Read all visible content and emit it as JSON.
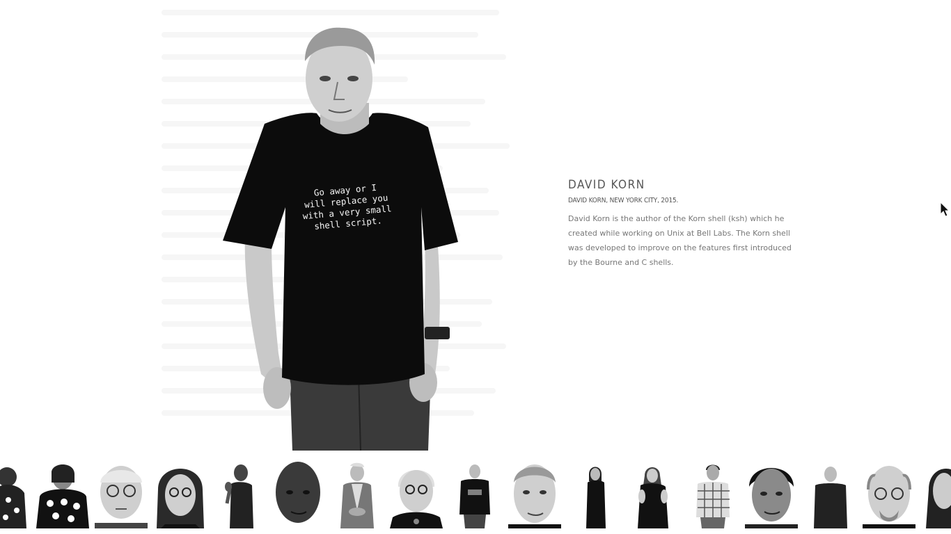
{
  "viewer": {
    "person_name": "DAVID KORN",
    "caption": "DAVID KORN, NEW YORK CITY, 2015.",
    "bio": "David Korn is the author of the Korn shell (ksh) which he created while working on Unix at Bell Labs. The Korn shell was developed to improve on the features first introduced by the Bourne and C shells.",
    "shirt_text": [
      "Go away or I",
      "will replace you",
      "with a very small",
      "shell script."
    ]
  },
  "thumbnails": [
    {
      "kind": "full",
      "tone": "pattern-dots"
    },
    {
      "kind": "full",
      "tone": "pattern-dots"
    },
    {
      "kind": "face",
      "tone": "bald-glasses"
    },
    {
      "kind": "face",
      "tone": "dark-hair-glasses"
    },
    {
      "kind": "full",
      "tone": "dark-skin-fist"
    },
    {
      "kind": "face",
      "tone": "dark-skin"
    },
    {
      "kind": "full",
      "tone": "elderly-woman-vest"
    },
    {
      "kind": "face",
      "tone": "elderly-woman-glasses"
    },
    {
      "kind": "full",
      "tone": "black-tshirt"
    },
    {
      "kind": "face",
      "tone": "grey-hair-man"
    },
    {
      "kind": "full",
      "tone": "woman-black-dress"
    },
    {
      "kind": "full",
      "tone": "woman-black-top"
    },
    {
      "kind": "full",
      "tone": "plaid-shirt"
    },
    {
      "kind": "face",
      "tone": "dark-hair-man"
    },
    {
      "kind": "full",
      "tone": "bald-dark-shirt"
    },
    {
      "kind": "face",
      "tone": "bald-glasses-beard"
    },
    {
      "kind": "full",
      "tone": "dark-hair-woman"
    }
  ]
}
